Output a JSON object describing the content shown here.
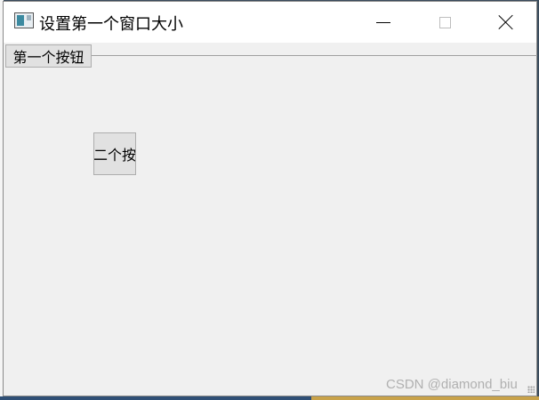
{
  "window": {
    "title": "设置第一个窗口大小",
    "minimize_icon": "minimize-icon",
    "maximize_icon": "maximize-icon",
    "close_icon": "close-icon"
  },
  "buttons": {
    "first_label": "第一个按钮",
    "second_label": "二个按"
  },
  "watermark": "CSDN @diamond_biu"
}
